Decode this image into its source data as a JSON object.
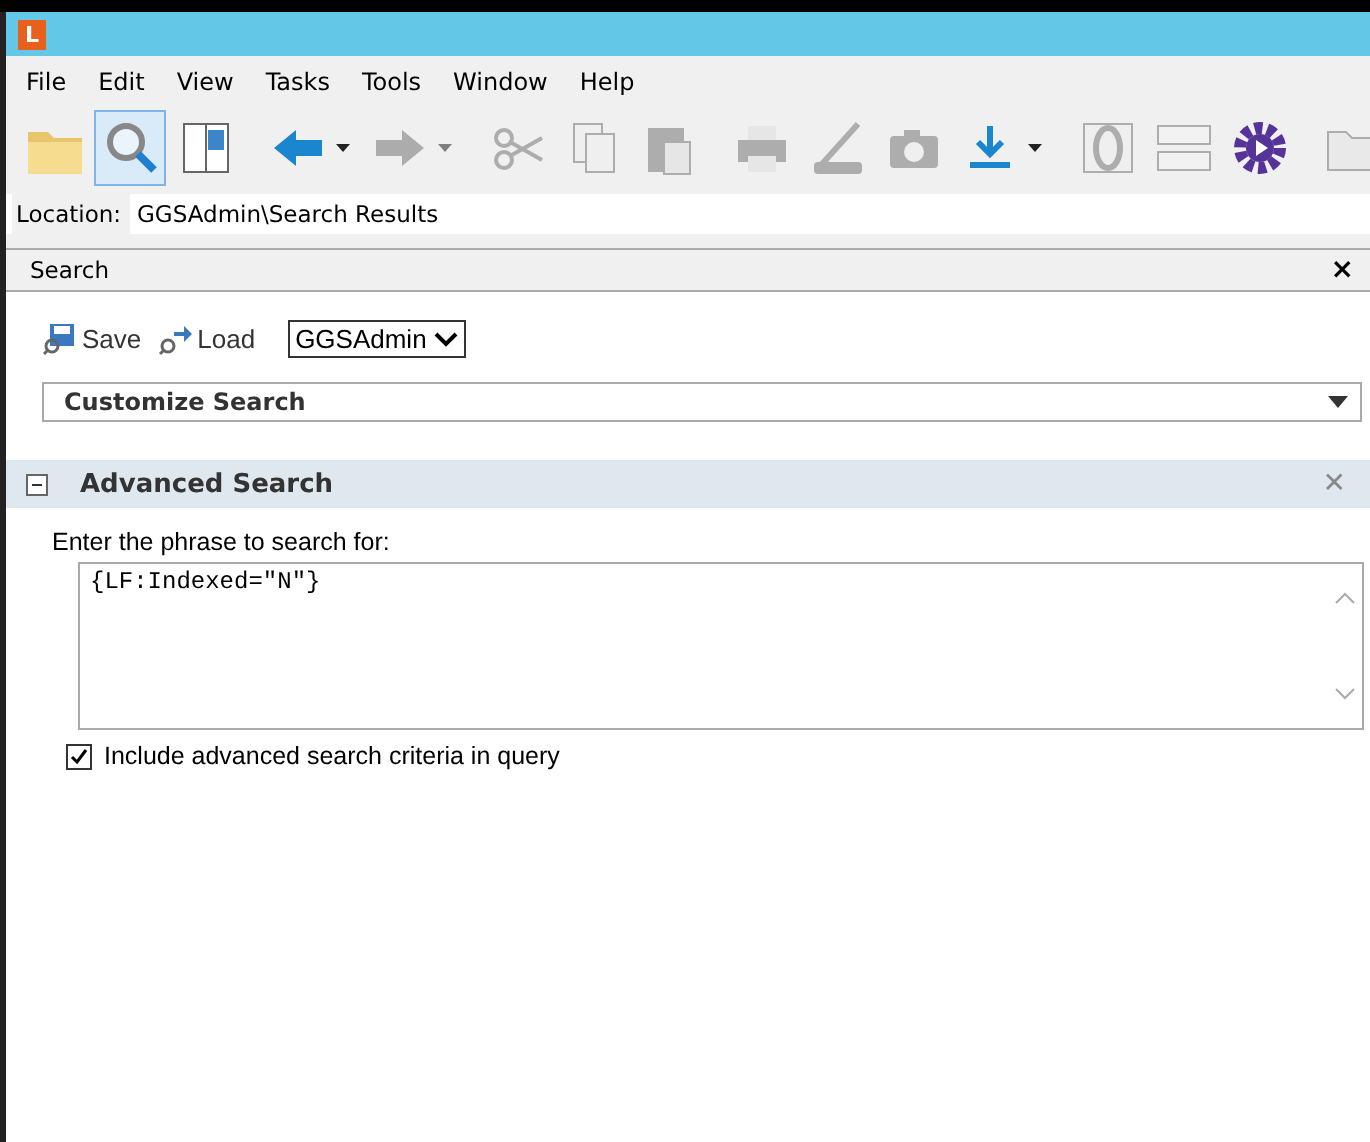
{
  "window": {
    "logo": "L"
  },
  "menu": [
    "File",
    "Edit",
    "View",
    "Tasks",
    "Tools",
    "Window",
    "Help"
  ],
  "toolbar": [
    {
      "kind": "folder",
      "selected": false,
      "disabled": false,
      "has_menu": false
    },
    {
      "kind": "search",
      "selected": true,
      "disabled": false,
      "has_menu": false
    },
    {
      "kind": "panel",
      "selected": false,
      "disabled": false,
      "has_menu": false
    },
    {
      "kind": "sep"
    },
    {
      "kind": "back",
      "selected": false,
      "disabled": false,
      "has_menu": true
    },
    {
      "kind": "forward",
      "selected": false,
      "disabled": true,
      "has_menu": true
    },
    {
      "kind": "sep"
    },
    {
      "kind": "cut",
      "selected": false,
      "disabled": true,
      "has_menu": false
    },
    {
      "kind": "copy",
      "selected": false,
      "disabled": true,
      "has_menu": false
    },
    {
      "kind": "paste",
      "selected": false,
      "disabled": true,
      "has_menu": false
    },
    {
      "kind": "sep"
    },
    {
      "kind": "print",
      "selected": false,
      "disabled": true,
      "has_menu": false
    },
    {
      "kind": "scan",
      "selected": false,
      "disabled": true,
      "has_menu": false
    },
    {
      "kind": "camera",
      "selected": false,
      "disabled": true,
      "has_menu": false
    },
    {
      "kind": "download",
      "selected": false,
      "disabled": false,
      "has_menu": true
    },
    {
      "kind": "sep"
    },
    {
      "kind": "template",
      "selected": false,
      "disabled": true,
      "has_menu": false
    },
    {
      "kind": "fields",
      "selected": false,
      "disabled": true,
      "has_menu": false
    },
    {
      "kind": "gear",
      "selected": false,
      "disabled": false,
      "has_menu": false
    },
    {
      "kind": "sep"
    },
    {
      "kind": "folder2",
      "selected": false,
      "disabled": true,
      "has_menu": false
    }
  ],
  "location": {
    "label": "Location:",
    "value": "GGSAdmin\\Search Results"
  },
  "panel": {
    "title": "Search",
    "close": "×"
  },
  "actions": [
    {
      "kind": "save",
      "label": "Save"
    },
    {
      "kind": "load",
      "label": "Load"
    }
  ],
  "repository": {
    "value": "GGSAdmin"
  },
  "customize": {
    "label": "Customize Search"
  },
  "advanced": {
    "title": "Advanced Search",
    "expanded": true,
    "close": "✕",
    "prompt": "Enter the phrase to search for:",
    "query": "{LF:Indexed=\"N\"}",
    "include": {
      "label": "Include advanced search criteria in query",
      "checked": true
    }
  }
}
